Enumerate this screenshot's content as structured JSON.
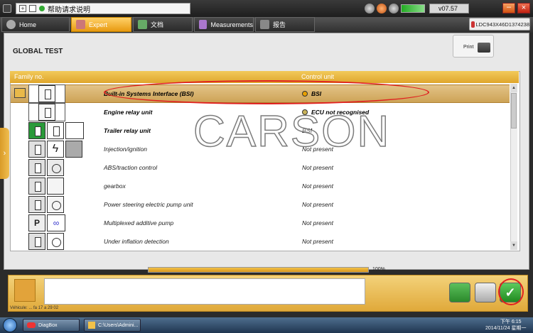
{
  "titlebar": {
    "title": "帮助请求说明",
    "version": "v07.57"
  },
  "tabs": [
    {
      "label": "Home",
      "icon": "home-icon"
    },
    {
      "label": "Expert",
      "icon": "search-icon"
    },
    {
      "label": "文档",
      "icon": "document-icon"
    },
    {
      "label": "Measurements",
      "icon": "waveform-icon"
    },
    {
      "label": "报告",
      "icon": "report-icon"
    }
  ],
  "serial": "LDC943X46D1374238",
  "main": {
    "title": "GLOBAL TEST",
    "print_label": "Print"
  },
  "table": {
    "headers": {
      "family": "Family no.",
      "control": "Control unit"
    },
    "rows": [
      {
        "family": "Built-in Systems Interface (BSI)",
        "control": "BSI",
        "bold": true
      },
      {
        "family": "Engine relay unit",
        "control": "ECU not recognised",
        "bold": true
      },
      {
        "family": "Trailer relay unit",
        "control": "BSI",
        "bold": true
      },
      {
        "family": "Injection/ignition",
        "control": "Not present",
        "bold": false
      },
      {
        "family": "ABS/traction control",
        "control": "Not present",
        "bold": false
      },
      {
        "family": "gearbox",
        "control": "Not present",
        "bold": false
      },
      {
        "family": "Power steering electric pump unit",
        "control": "Not present",
        "bold": false
      },
      {
        "family": "Multiplexed additive pump",
        "control": "Not present",
        "bold": false
      },
      {
        "family": "Under inflation detection",
        "control": "Not present",
        "bold": false
      }
    ]
  },
  "progress": {
    "value": 100,
    "label": "100%"
  },
  "vehicle_info": "Véhicule: ... fa 17 a 29 02",
  "watermark": "CARSON",
  "taskbar": {
    "items": [
      {
        "label": "DiagBox"
      },
      {
        "label": "C:\\Users\\Admini..."
      }
    ],
    "time": "下午 6:15",
    "date": "2014/11/24 星期一"
  },
  "colors": {
    "accent": "#e8a020",
    "header": "#dfa62c",
    "selected_row": "#d4ab60",
    "ok_green": "#2e9a2e",
    "annotation": "#e02020"
  }
}
